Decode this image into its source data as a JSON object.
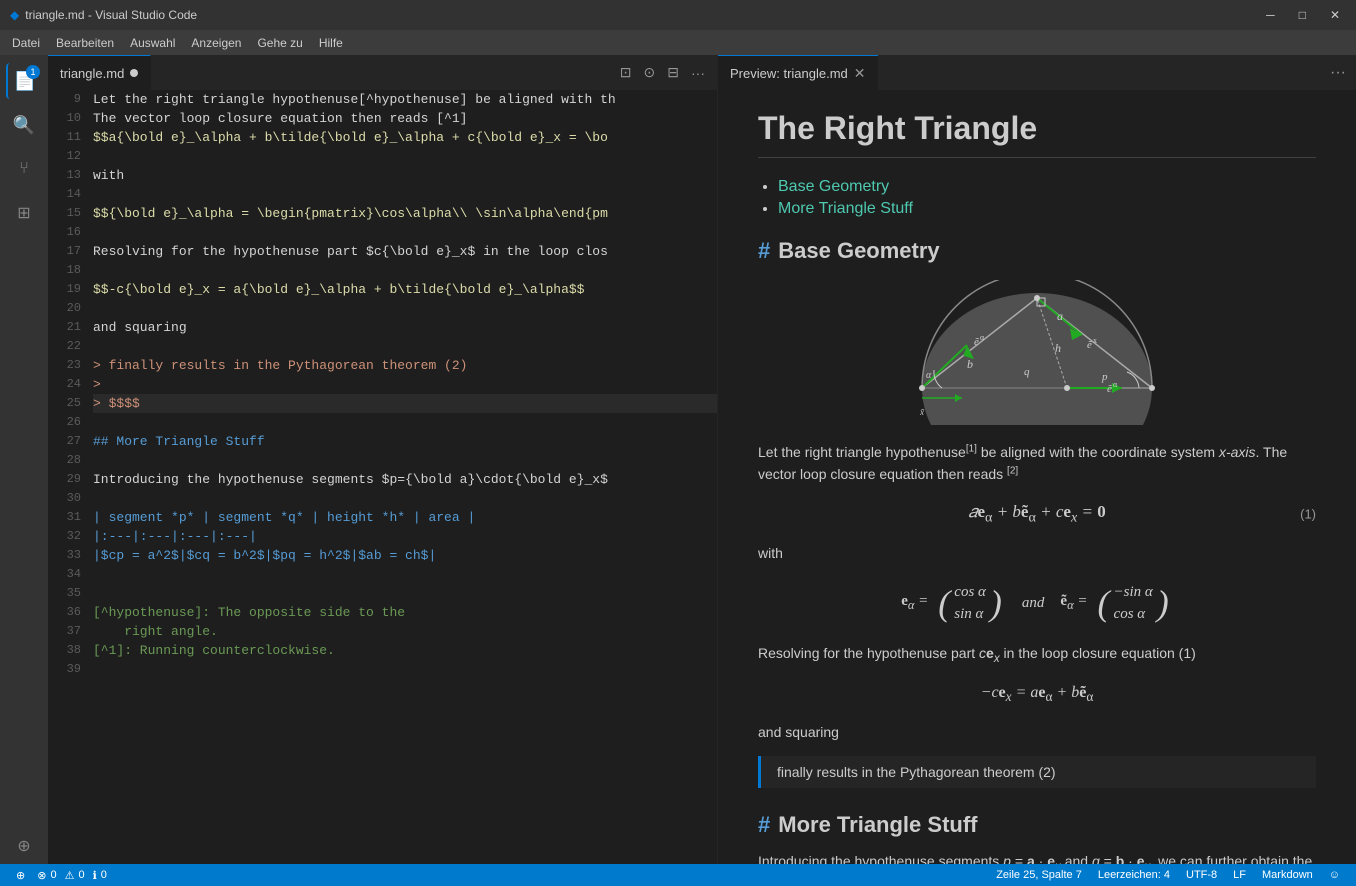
{
  "titlebar": {
    "title": "triangle.md - Visual Studio Code",
    "icon": "◆",
    "minimize": "─",
    "maximize": "□",
    "close": "✕"
  },
  "menubar": {
    "items": [
      "Datei",
      "Bearbeiten",
      "Auswahl",
      "Anzeigen",
      "Gehe zu",
      "Hilfe"
    ]
  },
  "activity": {
    "icons": [
      {
        "name": "explorer",
        "symbol": "⎘",
        "active": true,
        "badge": "1"
      },
      {
        "name": "search",
        "symbol": "🔍"
      },
      {
        "name": "source-control",
        "symbol": "⑂"
      },
      {
        "name": "extensions",
        "symbol": "⊞"
      },
      {
        "name": "remote",
        "symbol": "⊕"
      }
    ]
  },
  "editor": {
    "tab_filename": "triangle.md",
    "tab_modified": true,
    "lines": [
      {
        "num": 9,
        "text": "Let the right triangle hypothenuse[^hypothenuse] be aligned with th"
      },
      {
        "num": 10,
        "text": "The vector loop closure equation then reads [^1]"
      },
      {
        "num": 11,
        "text": "$$a{\\bold e}_\\alpha + b\\tilde{\\bold e}_\\alpha + c{\\bold e}_x = \\bo"
      },
      {
        "num": 12,
        "text": ""
      },
      {
        "num": 13,
        "text": "with"
      },
      {
        "num": 14,
        "text": ""
      },
      {
        "num": 15,
        "text": "$${\\bold e}_\\alpha = \\begin{pmatrix}\\cos\\alpha\\\\ \\sin\\alpha\\end{pm"
      },
      {
        "num": 16,
        "text": ""
      },
      {
        "num": 17,
        "text": "Resolving for the hypothenuse part $c{\\bold e}_x$ in the loop clos"
      },
      {
        "num": 18,
        "text": ""
      },
      {
        "num": 19,
        "text": "$$-c{\\bold e}_x = a{\\bold e}_\\alpha + b\\tilde{\\bold e}_\\alpha$$"
      },
      {
        "num": 20,
        "text": ""
      },
      {
        "num": 21,
        "text": "and squaring"
      },
      {
        "num": 22,
        "text": ""
      },
      {
        "num": 23,
        "text": "> finally results in the Pythagorean theorem (2)"
      },
      {
        "num": 24,
        "text": ">"
      },
      {
        "num": 25,
        "text": "> $$$$"
      },
      {
        "num": 26,
        "text": ""
      },
      {
        "num": 27,
        "text": "## More Triangle Stuff"
      },
      {
        "num": 28,
        "text": ""
      },
      {
        "num": 29,
        "text": "Introducing the hypothenuse segments $p={\\bold a}\\cdot{\\bold e}_x$"
      },
      {
        "num": 30,
        "text": ""
      },
      {
        "num": 31,
        "text": "| segment *p* | segment *q* | height *h* | area |"
      },
      {
        "num": 32,
        "text": "|:---|:---|:---|:---|"
      },
      {
        "num": 33,
        "text": "|$cp = a^2$|$cq = b^2$|$pq = h^2$|$ab = ch$|"
      },
      {
        "num": 34,
        "text": ""
      },
      {
        "num": 35,
        "text": ""
      },
      {
        "num": 36,
        "text": "[^hypothenuse]: The opposite side to the"
      },
      {
        "num": 37,
        "text": "    right angle."
      },
      {
        "num": 38,
        "text": "[^1]: Running counterclockwise."
      },
      {
        "num": 39,
        "text": ""
      }
    ]
  },
  "preview": {
    "tab_title": "Preview: triangle.md",
    "title": "The Right Triangle",
    "toc": {
      "items": [
        "Base Geometry",
        "More Triangle Stuff"
      ]
    },
    "section_base": "Base Geometry",
    "section_more": "More Triangle Stuff",
    "para1": "Let the right triangle hypothenuse",
    "para1_sup1": "[1]",
    "para1_cont": " be aligned with the coordinate system ",
    "para1_em": "x-axis",
    "para1_cont2": ". The vector loop closure equation then reads ",
    "para1_sup2": "[2]",
    "equation1": "aeα + bẽα + ceₓ = 0",
    "eq1_number": "(1)",
    "with": "with",
    "eq_ea_left": "eα =",
    "matrix1_r1": "cos α",
    "matrix1_r2": "sin α",
    "and_text": "and",
    "eq_ea_tilde": "ẽα =",
    "matrix2_r1": "−sin α",
    "matrix2_r2": "cos α",
    "resolving_text": "Resolving for the hypothenuse part ceₓ in the loop closure equation (1)",
    "equation2": "−ceₓ = aeα + bẽα",
    "and_squaring": "and squaring",
    "blockquote": "finally results in the Pythagorean theorem (2)",
    "more_intro": "Introducing the hypothenuse segments p = a · eₓ and q = b · eₓ, we can further obtain the"
  },
  "statusbar": {
    "errors": "0",
    "warnings": "0",
    "info": "0",
    "position": "Zeile 25, Spalte 7",
    "spaces": "Leerzeichen: 4",
    "encoding": "UTF-8",
    "line_ending": "LF",
    "language": "Markdown"
  }
}
